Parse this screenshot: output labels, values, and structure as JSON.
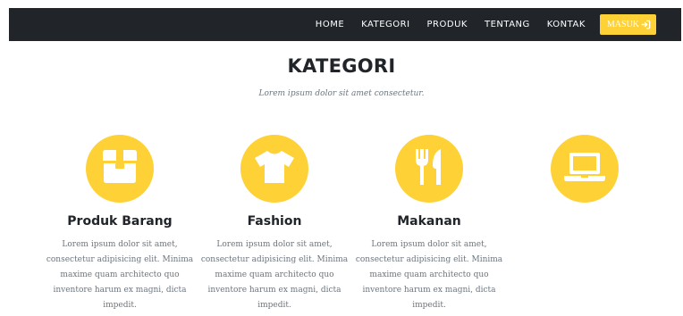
{
  "nav": {
    "items": [
      "HOME",
      "KATEGORI",
      "PRODUK",
      "TENTANG",
      "KONTAK"
    ],
    "login_label": "MASUK",
    "login_icon": "sign-in-icon"
  },
  "section": {
    "title": "KATEGORI",
    "subtitle": "Lorem ipsum dolor sit amet consectetur."
  },
  "categories": [
    {
      "icon": "box-icon",
      "title": "Produk Barang",
      "desc": "Lorem ipsum dolor sit amet, consectetur adipisicing elit. Minima maxime quam architecto quo inventore harum ex magni, dicta impedit."
    },
    {
      "icon": "tshirt-icon",
      "title": "Fashion",
      "desc": "Lorem ipsum dolor sit amet, consectetur adipisicing elit. Minima maxime quam architecto quo inventore harum ex magni, dicta impedit."
    },
    {
      "icon": "utensils-icon",
      "title": "Makanan",
      "desc": "Lorem ipsum dolor sit amet, consectetur adipisicing elit. Minima maxime quam architecto quo inventore harum ex magni, dicta impedit."
    },
    {
      "icon": "laptop-icon",
      "title": "",
      "desc": ""
    }
  ],
  "colors": {
    "accent": "#fed136",
    "navbar_bg": "#212529",
    "text_dark": "#212529",
    "text_muted": "#6c757d"
  }
}
